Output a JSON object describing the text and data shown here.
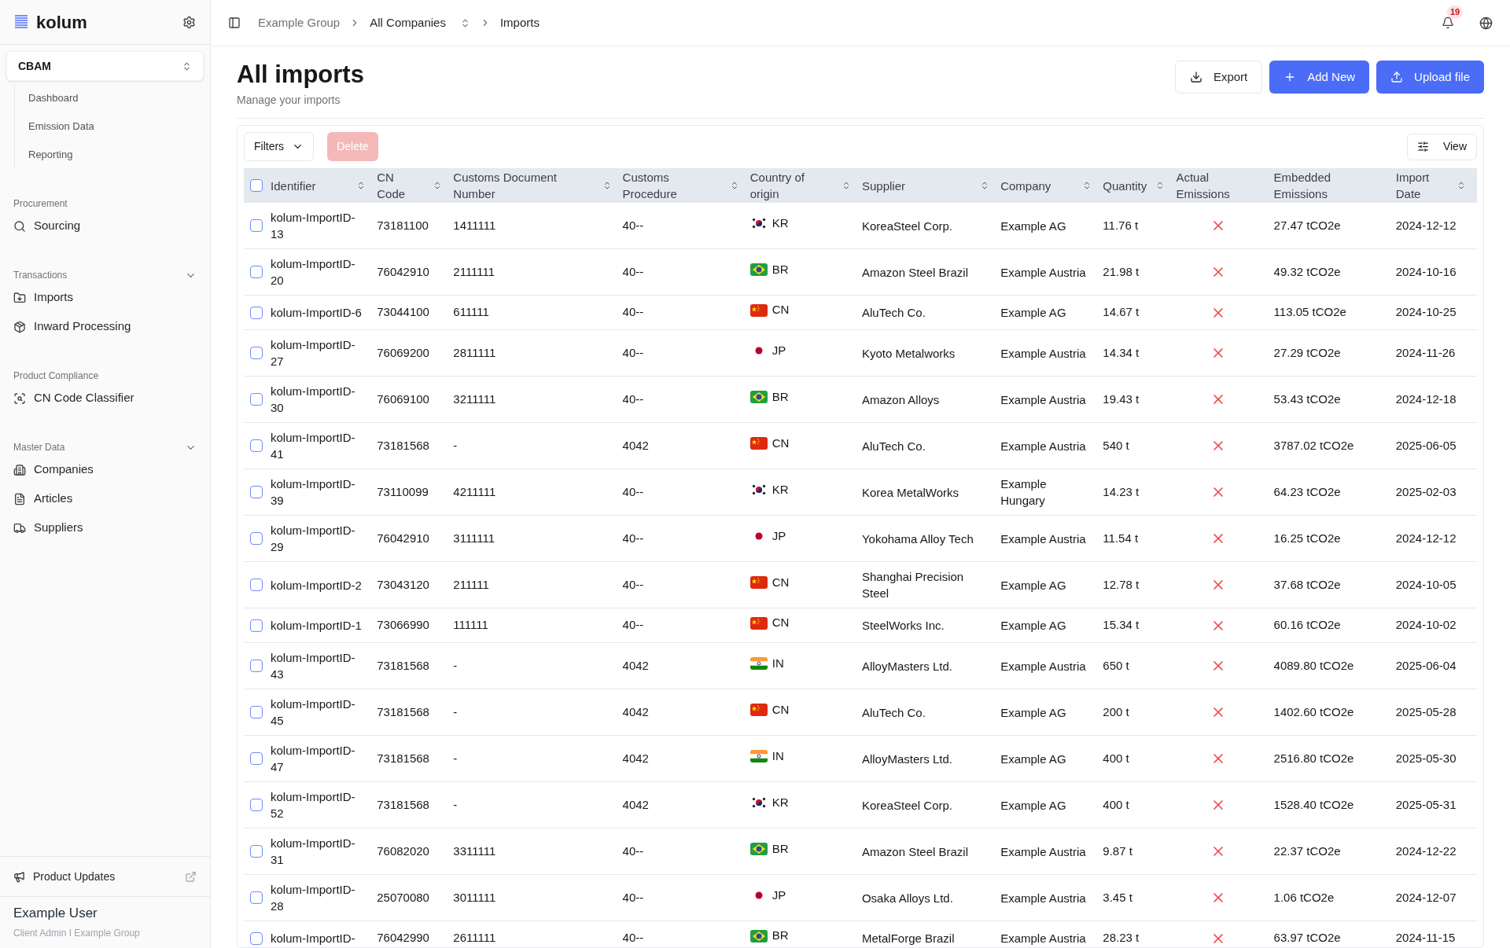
{
  "sidebar": {
    "brand": "kolum",
    "module": "CBAM",
    "module_items": [
      "Dashboard",
      "Emission Data",
      "Reporting"
    ],
    "sections": [
      {
        "title": "Procurement",
        "collapsible": false,
        "items": [
          "Sourcing"
        ]
      },
      {
        "title": "Transactions",
        "collapsible": true,
        "items": [
          "Imports",
          "Inward Processing"
        ]
      },
      {
        "title": "Product Compliance",
        "collapsible": false,
        "items": [
          "CN Code Classifier"
        ]
      },
      {
        "title": "Master Data",
        "collapsible": true,
        "items": [
          "Companies",
          "Articles",
          "Suppliers"
        ]
      }
    ],
    "product_updates": "Product Updates",
    "user": {
      "name": "Example User",
      "role": "Client Admin I Example Group"
    }
  },
  "breadcrumb": [
    "Example Group",
    "All Companies",
    "Imports"
  ],
  "notifications": "19",
  "page": {
    "title": "All imports",
    "subtitle": "Manage your imports",
    "buttons": [
      "Export",
      "Add New",
      "Upload file"
    ]
  },
  "toolbar": {
    "filters": "Filters",
    "delete": "Delete",
    "view": "View"
  },
  "table": {
    "all_checked": false,
    "columns": [
      "Identifier",
      "CN Code",
      "Customs Document Number",
      "Customs Procedure",
      "Country of origin",
      "Supplier",
      "Company",
      "Quantity",
      "Actual Emissions",
      "Embedded Emissions",
      "Import Date"
    ],
    "rows": [
      {
        "checked": false,
        "id": "kolum-ImportID-13",
        "cn": "73181100",
        "doc": "1411111",
        "proc": "40--",
        "kind": "korea",
        "country": "KR",
        "supplier": "KoreaSteel Corp.",
        "company": "Example AG",
        "qty": "11.76 t",
        "actual": false,
        "embedded": "27.47 tCO2e",
        "date": "2024-12-12"
      },
      {
        "checked": false,
        "id": "kolum-ImportID-20",
        "cn": "76042910",
        "doc": "2111111",
        "proc": "40--",
        "kind": "brazil",
        "country": "BR",
        "supplier": "Amazon Steel Brazil",
        "company": "Example Austria",
        "qty": "21.98 t",
        "actual": false,
        "embedded": "49.32 tCO2e",
        "date": "2024-10-16"
      },
      {
        "checked": false,
        "id": "kolum-ImportID-6",
        "cn": "73044100",
        "doc": "611111",
        "proc": "40--",
        "kind": "china",
        "country": "CN",
        "supplier": "AluTech Co.",
        "company": "Example AG",
        "qty": "14.67 t",
        "actual": false,
        "embedded": "113.05 tCO2e",
        "date": "2024-10-25"
      },
      {
        "checked": false,
        "id": "kolum-ImportID-27",
        "cn": "76069200",
        "doc": "2811111",
        "proc": "40--",
        "kind": "japan",
        "country": "JP",
        "supplier": "Kyoto Metalworks",
        "company": "Example Austria",
        "qty": "14.34 t",
        "actual": false,
        "embedded": "27.29 tCO2e",
        "date": "2024-11-26"
      },
      {
        "checked": false,
        "id": "kolum-ImportID-30",
        "cn": "76069100",
        "doc": "3211111",
        "proc": "40--",
        "kind": "brazil",
        "country": "BR",
        "supplier": "Amazon Alloys",
        "company": "Example Austria",
        "qty": "19.43 t",
        "actual": false,
        "embedded": "53.43 tCO2e",
        "date": "2024-12-18"
      },
      {
        "checked": false,
        "id": "kolum-ImportID-41",
        "cn": "73181568",
        "doc": "-",
        "proc": "4042",
        "kind": "china",
        "country": "CN",
        "supplier": "AluTech Co.",
        "company": "Example Austria",
        "qty": "540 t",
        "actual": false,
        "embedded": "3787.02 tCO2e",
        "date": "2025-06-05"
      },
      {
        "checked": false,
        "id": "kolum-ImportID-39",
        "cn": "73110099",
        "doc": "4211111",
        "proc": "40--",
        "kind": "korea",
        "country": "KR",
        "supplier": "Korea MetalWorks",
        "company": "Example Hungary",
        "qty": "14.23 t",
        "actual": false,
        "embedded": "64.23 tCO2e",
        "date": "2025-02-03"
      },
      {
        "checked": false,
        "id": "kolum-ImportID-29",
        "cn": "76042910",
        "doc": "3111111",
        "proc": "40--",
        "kind": "japan",
        "country": "JP",
        "supplier": "Yokohama Alloy Tech",
        "company": "Example Austria",
        "qty": "11.54 t",
        "actual": false,
        "embedded": "16.25 tCO2e",
        "date": "2024-12-12"
      },
      {
        "checked": false,
        "id": "kolum-ImportID-2",
        "cn": "73043120",
        "doc": "211111",
        "proc": "40--",
        "kind": "china",
        "country": "CN",
        "supplier": "Shanghai Precision Steel",
        "company": "Example AG",
        "qty": "12.78 t",
        "actual": false,
        "embedded": "37.68 tCO2e",
        "date": "2024-10-05"
      },
      {
        "checked": false,
        "id": "kolum-ImportID-1",
        "cn": "73066990",
        "doc": "111111",
        "proc": "40--",
        "kind": "china",
        "country": "CN",
        "supplier": "SteelWorks Inc.",
        "company": "Example AG",
        "qty": "15.34 t",
        "actual": false,
        "embedded": "60.16 tCO2e",
        "date": "2024-10-02"
      },
      {
        "checked": false,
        "id": "kolum-ImportID-43",
        "cn": "73181568",
        "doc": "-",
        "proc": "4042",
        "kind": "india",
        "country": "IN",
        "supplier": "AlloyMasters Ltd.",
        "company": "Example Austria",
        "qty": "650 t",
        "actual": false,
        "embedded": "4089.80 tCO2e",
        "date": "2025-06-04"
      },
      {
        "checked": false,
        "id": "kolum-ImportID-45",
        "cn": "73181568",
        "doc": "-",
        "proc": "4042",
        "kind": "china",
        "country": "CN",
        "supplier": "AluTech Co.",
        "company": "Example AG",
        "qty": "200 t",
        "actual": false,
        "embedded": "1402.60 tCO2e",
        "date": "2025-05-28"
      },
      {
        "checked": false,
        "id": "kolum-ImportID-47",
        "cn": "73181568",
        "doc": "-",
        "proc": "4042",
        "kind": "india",
        "country": "IN",
        "supplier": "AlloyMasters Ltd.",
        "company": "Example AG",
        "qty": "400 t",
        "actual": false,
        "embedded": "2516.80 tCO2e",
        "date": "2025-05-30"
      },
      {
        "checked": false,
        "id": "kolum-ImportID-52",
        "cn": "73181568",
        "doc": "-",
        "proc": "4042",
        "kind": "korea",
        "country": "KR",
        "supplier": "KoreaSteel Corp.",
        "company": "Example AG",
        "qty": "400 t",
        "actual": false,
        "embedded": "1528.40 tCO2e",
        "date": "2025-05-31"
      },
      {
        "checked": false,
        "id": "kolum-ImportID-31",
        "cn": "76082020",
        "doc": "3311111",
        "proc": "40--",
        "kind": "brazil",
        "country": "BR",
        "supplier": "Amazon Steel Brazil",
        "company": "Example Austria",
        "qty": "9.87 t",
        "actual": false,
        "embedded": "22.37 tCO2e",
        "date": "2024-12-22"
      },
      {
        "checked": false,
        "id": "kolum-ImportID-28",
        "cn": "25070080",
        "doc": "3011111",
        "proc": "40--",
        "kind": "japan",
        "country": "JP",
        "supplier": "Osaka Alloys Ltd.",
        "company": "Example Austria",
        "qty": "3.45 t",
        "actual": false,
        "embedded": "1.06 tCO2e",
        "date": "2024-12-07"
      },
      {
        "checked": false,
        "id": "kolum-ImportID-",
        "cn": "76042990",
        "doc": "2611111",
        "proc": "40--",
        "kind": "brazil",
        "country": "BR",
        "supplier": "MetalForge Brazil",
        "company": "Example Austria",
        "qty": "28.23 t",
        "actual": false,
        "embedded": "63.97 tCO2e",
        "date": "2024-11-15"
      }
    ]
  }
}
